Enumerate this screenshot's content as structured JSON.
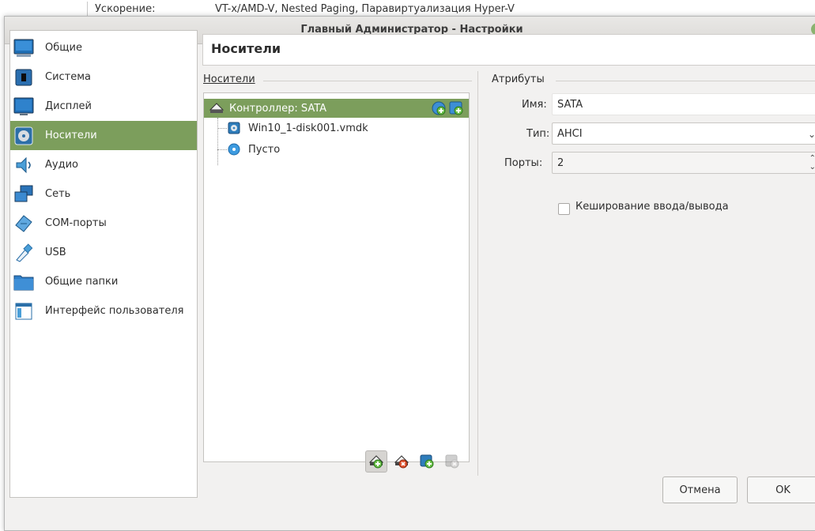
{
  "background_window": {
    "label": "Ускорение:",
    "value": "VT-x/AMD-V, Nested Paging, Паравиртуализация Hyper-V"
  },
  "window": {
    "title": "Главный Администратор - Настройки"
  },
  "sidebar": {
    "items": [
      {
        "label": "Общие",
        "icon": "general-icon"
      },
      {
        "label": "Система",
        "icon": "system-icon"
      },
      {
        "label": "Дисплей",
        "icon": "display-icon"
      },
      {
        "label": "Носители",
        "icon": "storage-icon",
        "active": true
      },
      {
        "label": "Аудио",
        "icon": "audio-icon"
      },
      {
        "label": "Сеть",
        "icon": "network-icon"
      },
      {
        "label": "COM-порты",
        "icon": "serial-ports-icon"
      },
      {
        "label": "USB",
        "icon": "usb-icon"
      },
      {
        "label": "Общие папки",
        "icon": "shared-folders-icon"
      },
      {
        "label": "Интерфейс пользователя",
        "icon": "user-interface-icon"
      }
    ]
  },
  "page": {
    "title": "Носители"
  },
  "storage": {
    "legend": "Носители",
    "tree": [
      {
        "label": "Контроллер: SATA",
        "icon": "controller-icon",
        "selected": true
      },
      {
        "label": "Win10_1-disk001.vmdk",
        "icon": "hard-disk-icon"
      },
      {
        "label": "Пусто",
        "icon": "optical-disc-icon"
      }
    ],
    "toolbar": [
      "add-controller-icon",
      "remove-controller-icon",
      "add-attachment-icon",
      "remove-attachment-icon"
    ]
  },
  "attributes": {
    "legend": "Атрибуты",
    "name_label": "Имя:",
    "name_value": "SATA",
    "type_label": "Тип:",
    "type_value": "AHCI",
    "ports_label": "Порты:",
    "ports_value": "2",
    "cache_label": "Кеширование ввода/вывода",
    "cache_checked": false
  },
  "buttons": {
    "cancel": "Отмена",
    "ok": "OK"
  },
  "colors": {
    "selection": "#7c9e5c",
    "accent_icon": "#2e7dbb"
  }
}
